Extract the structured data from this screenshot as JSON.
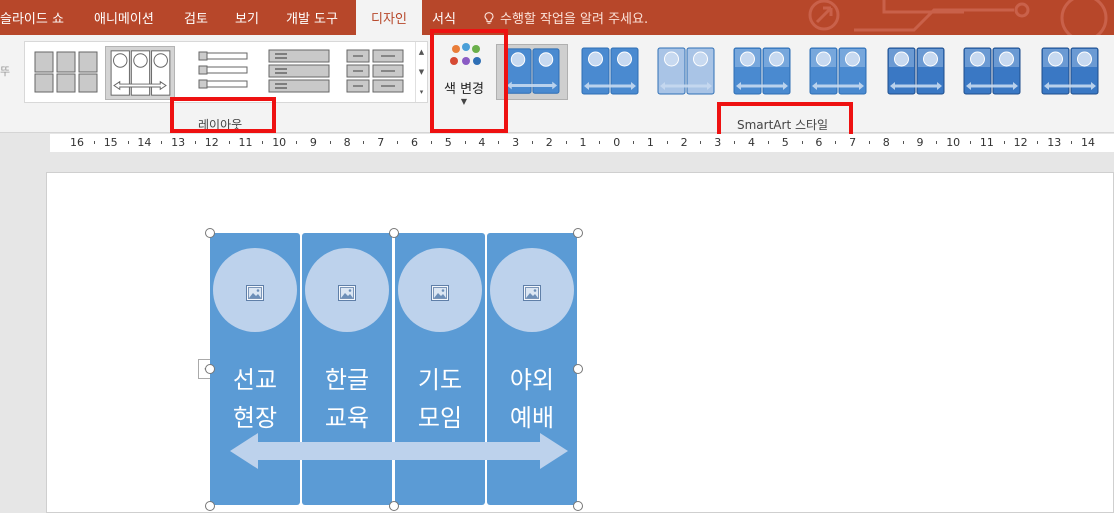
{
  "tabs": [
    {
      "id": "slideshow",
      "label": "슬라이드 쇼",
      "active": false
    },
    {
      "id": "animation",
      "label": "애니메이션",
      "active": false
    },
    {
      "id": "review",
      "label": "검토",
      "active": false
    },
    {
      "id": "view",
      "label": "보기",
      "active": false
    },
    {
      "id": "developer",
      "label": "개발 도구",
      "active": false
    },
    {
      "id": "design",
      "label": "디자인",
      "active": true
    },
    {
      "id": "format",
      "label": "서식",
      "active": false
    }
  ],
  "tell_me": {
    "text": "수행할 작업을 알려 주세요.",
    "icon": "lightbulb-icon"
  },
  "ribbon": {
    "layout_group_label": "레이아웃",
    "color_button_label": "색 변경",
    "style_group_label": "SmartArt 스타일",
    "left_edge_glyph": "뚜"
  },
  "ruler": {
    "labels": [
      "16",
      "15",
      "14",
      "13",
      "12",
      "11",
      "10",
      "9",
      "8",
      "7",
      "6",
      "5",
      "4",
      "3",
      "2",
      "1",
      "0",
      "1",
      "2",
      "3",
      "4",
      "5",
      "6",
      "7",
      "8",
      "9",
      "10",
      "11",
      "12",
      "13",
      "14"
    ]
  },
  "smartart": {
    "columns": [
      {
        "line1": "선교",
        "line2": "현장"
      },
      {
        "line1": "한글",
        "line2": "교육"
      },
      {
        "line1": "기도",
        "line2": "모임"
      },
      {
        "line1": "야외",
        "line2": "예배"
      }
    ],
    "fill_color": "#5b9bd5",
    "circle_color": "#bdd2ec",
    "arrow_color": "#bdd2ec"
  },
  "colors": {
    "tab_bar": "#b7472a",
    "ribbon_bg": "#f3f3f3",
    "highlight_box": "#ee1111"
  }
}
